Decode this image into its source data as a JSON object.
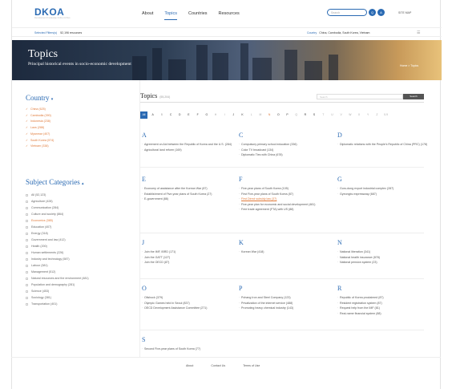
{
  "header": {
    "logo": "DKOA",
    "tagline": "Development Knowledge Online Archive",
    "nav": [
      "About",
      "Topics",
      "Countries",
      "Resources"
    ],
    "search_placeholder": "Search",
    "circle1": "Q",
    "circle2": "A",
    "sitemap": "SITE MAP"
  },
  "subbar": {
    "left_label": "Selected Filters(s)",
    "left_value": "52,196 resources",
    "right_label": "Country",
    "right_value": "China, Cambodia, South Korea, Vietnam"
  },
  "banner": {
    "title": "Topics",
    "subtitle": "Principal historical events in socio-economic development",
    "crumb": "Home > Topics"
  },
  "sidebar": {
    "country_heading": "Country",
    "countries": [
      "China (625)",
      "Cambodia (390)",
      "Indonesia (238)",
      "Laos (288)",
      "Myanmar (407)",
      "South Korea (574)",
      "Vietnam (338)"
    ],
    "subject_heading": "Subject Categories",
    "subjects": [
      "All (52,123)",
      "Agriculture (428)",
      "Communication (284)",
      "Culture and society (864)",
      "Economics (385)",
      "Education (407)",
      "Energy (318)",
      "Government and law (412)",
      "Health (200)",
      "Human settlements (226)",
      "Industry and technology (587)",
      "Labour (381)",
      "Management (512)",
      "Natural resources and the environment (481)",
      "Population and demography (281)",
      "Science (453)",
      "Sociology (381)",
      "Transportation (401)"
    ]
  },
  "main": {
    "title": "Topics",
    "count": "(55,204)",
    "search_placeholder": "Search",
    "search_button": "Search",
    "alphabet": [
      "All",
      "A",
      "B",
      "C",
      "D",
      "E",
      "F",
      "G",
      "H",
      "I",
      "J",
      "K",
      "L",
      "M",
      "N",
      "O",
      "P",
      "Q",
      "R",
      "S",
      "T",
      "U",
      "V",
      "W",
      "X",
      "Y",
      "Z",
      "0-9"
    ],
    "sections": [
      {
        "letter": "A",
        "items": [
          "Agreement on Aid between the Republic of Korea and the U.S. (284)",
          "Agricultural land reform (169)"
        ]
      },
      {
        "letter": "C",
        "items": [
          "Compulsory primary school education (336)",
          "Color TV broadcast (134)",
          "Diplomatic Ties with China (678)"
        ]
      },
      {
        "letter": "D",
        "items": [
          "Diplomatic relations with the People's Republic of China (PRC) (178)"
        ]
      },
      {
        "letter": "E",
        "items": [
          "Economy of assistance after the Korean War (87)",
          "Establishment of Five-year plans of South Korea (27)",
          "E-government (88)"
        ]
      },
      {
        "letter": "F",
        "items": [
          "Five-year plans of South Korea (105)",
          "First Five-year plans of South Korea (87)",
          "First Direct subsidy law (37)",
          "Five-year plan for economic and social development (481)",
          "Free trade agreement (FTA) with US (88)"
        ]
      },
      {
        "letter": "G",
        "items": [
          "Guro-dong export industrial complex (287)",
          "Gyeongbu expressway (687)"
        ]
      },
      {
        "letter": "J",
        "items": [
          "Join the IMF, IBRD (171)",
          "Join the GATT (127)",
          "Join the OECD (87)"
        ]
      },
      {
        "letter": "K",
        "items": [
          "Korean War (418)"
        ]
      },
      {
        "letter": "N",
        "items": [
          "National liberation (341)",
          "National health insurance (878)",
          "National pension system (23)"
        ]
      },
      {
        "letter": "O",
        "items": [
          "Oilshock (379)",
          "Olympic Games held in Seoul (837)",
          "OECD Development Assistance Committee (271)"
        ]
      },
      {
        "letter": "P",
        "items": [
          "Pohang Iron and Steel Company (123)",
          "Privatization of the internet service (488)",
          "Promoting heavy chemical industry (143)"
        ]
      },
      {
        "letter": "R",
        "items": [
          "Republic of Korea proclaimed (87)",
          "Resident registration system (87)",
          "Request help from the IMF (81)",
          "Real-name financial system (88)"
        ]
      },
      {
        "letter": "S",
        "items": [
          "Second Five-year plans of South Korea (77)"
        ]
      }
    ]
  },
  "footer": {
    "links": [
      "About",
      "Contact Us",
      "Terms of Use"
    ]
  }
}
